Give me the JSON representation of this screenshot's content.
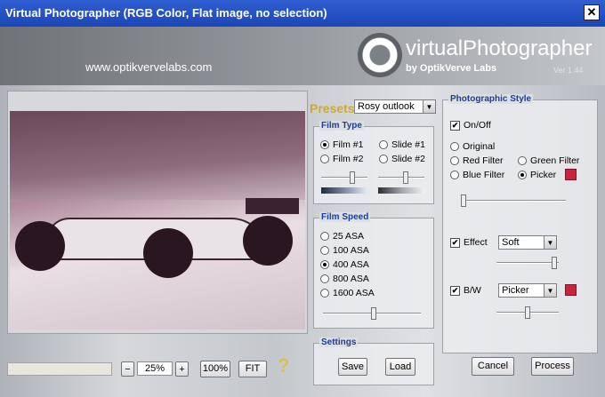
{
  "window": {
    "title": "Virtual Photographer (RGB Color, Flat image, no selection)",
    "close_glyph": "✕"
  },
  "header": {
    "website": "www.optikvervelabs.com",
    "logo_title": "virtualPhotographer",
    "logo_subtitle": "by OptikVerve Labs",
    "version": "Ver 1.44"
  },
  "preview": {
    "zoom_minus": "−",
    "zoom_value": "25%",
    "zoom_plus": "+",
    "zoom_100": "100%",
    "zoom_fit": "FIT",
    "help_glyph": "?"
  },
  "presets": {
    "label": "Presets",
    "selected": "Rosy outlook"
  },
  "film_type": {
    "title": "Film Type",
    "options": [
      {
        "label": "Film #1",
        "checked": true
      },
      {
        "label": "Slide #1",
        "checked": false
      },
      {
        "label": "Film #2",
        "checked": false
      },
      {
        "label": "Slide #2",
        "checked": false
      }
    ]
  },
  "film_speed": {
    "title": "Film Speed",
    "options": [
      {
        "label": "25 ASA",
        "checked": false
      },
      {
        "label": "100 ASA",
        "checked": false
      },
      {
        "label": "400 ASA",
        "checked": true
      },
      {
        "label": "800 ASA",
        "checked": false
      },
      {
        "label": "1600 ASA",
        "checked": false
      }
    ]
  },
  "settings": {
    "title": "Settings",
    "save": "Save",
    "load": "Load"
  },
  "photographic_style": {
    "title": "Photographic Style",
    "onoff": {
      "label": "On/Off",
      "checked": true
    },
    "filters": [
      {
        "label": "Original",
        "checked": false
      },
      {
        "label": "Red Filter",
        "checked": false
      },
      {
        "label": "Green Filter",
        "checked": false
      },
      {
        "label": "Blue Filter",
        "checked": false
      },
      {
        "label": "Picker",
        "checked": true
      }
    ],
    "picker_color": "#c8243d",
    "effect": {
      "label": "Effect",
      "checked": true,
      "selected": "Soft"
    },
    "bw": {
      "label": "B/W",
      "checked": true,
      "selected": "Picker",
      "color": "#c8243d"
    }
  },
  "actions": {
    "cancel": "Cancel",
    "process": "Process"
  }
}
